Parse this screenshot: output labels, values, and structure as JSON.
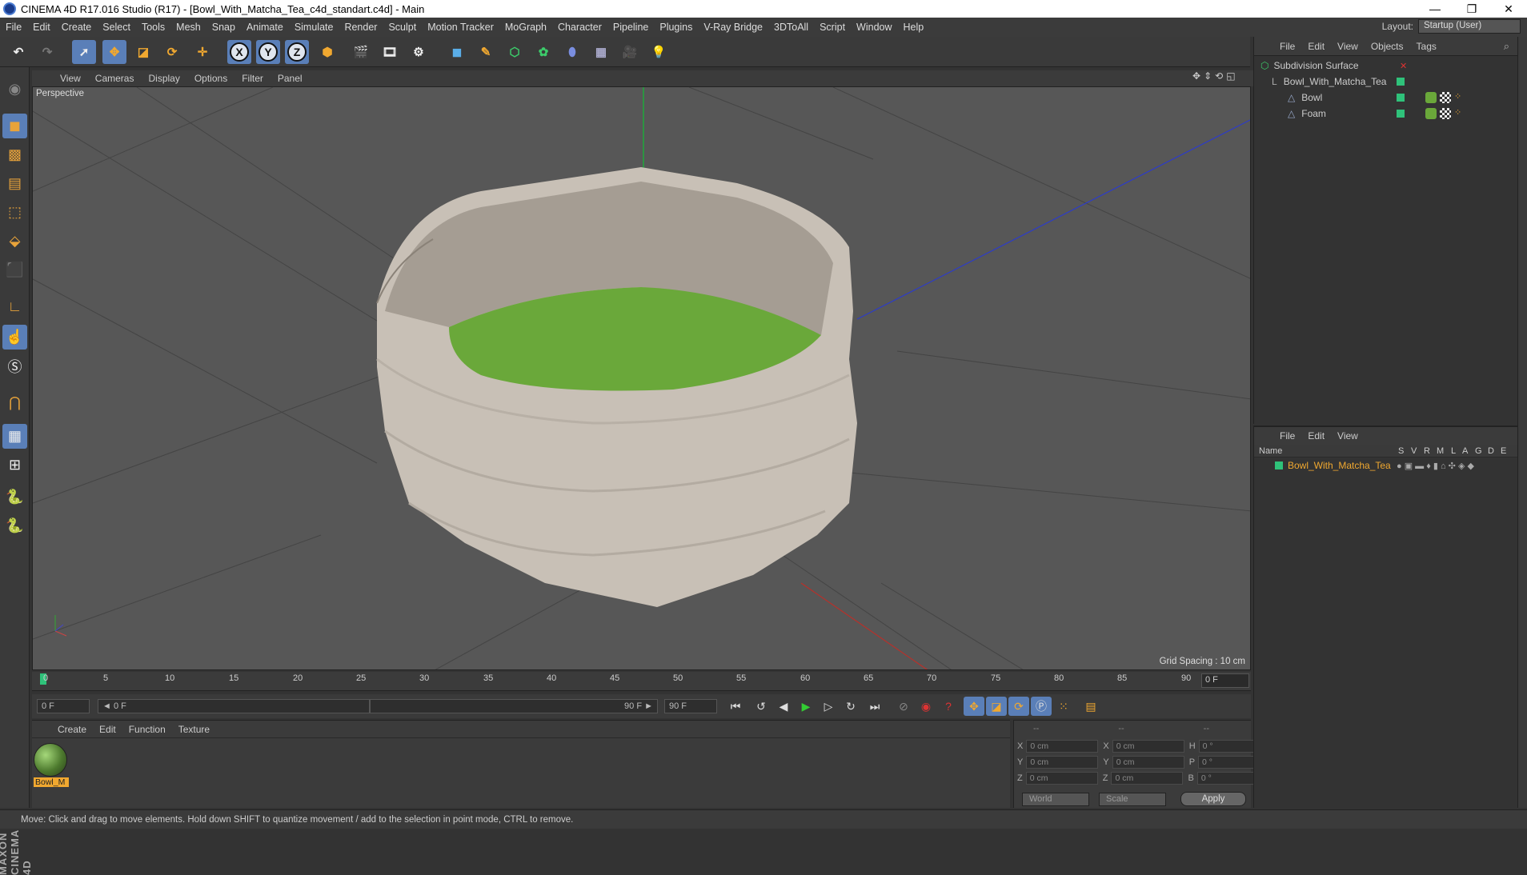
{
  "title": "CINEMA 4D R17.016 Studio (R17) - [Bowl_With_Matcha_Tea_c4d_standart.c4d] - Main",
  "window_buttons": [
    "—",
    "❐",
    "✕"
  ],
  "menu": [
    "File",
    "Edit",
    "Create",
    "Select",
    "Tools",
    "Mesh",
    "Snap",
    "Animate",
    "Simulate",
    "Render",
    "Sculpt",
    "Motion Tracker",
    "MoGraph",
    "Character",
    "Pipeline",
    "Plugins",
    "V-Ray Bridge",
    "3DToAll",
    "Script",
    "Window",
    "Help"
  ],
  "layout": {
    "label": "Layout:",
    "value": "Startup (User)"
  },
  "viewport": {
    "menu": [
      "View",
      "Cameras",
      "Display",
      "Options",
      "Filter",
      "Panel"
    ],
    "label": "Perspective",
    "grid_spacing": "Grid Spacing : 10 cm"
  },
  "timeline": {
    "ticks": [
      "0",
      "5",
      "10",
      "15",
      "20",
      "25",
      "30",
      "35",
      "40",
      "45",
      "50",
      "55",
      "60",
      "65",
      "70",
      "75",
      "80",
      "85",
      "90"
    ],
    "current_frame": "0 F"
  },
  "transport": {
    "start": "0 F",
    "range_start": "◄ 0 F",
    "range_end": "90 F ►",
    "end": "90 F"
  },
  "material": {
    "menu": [
      "Create",
      "Edit",
      "Function",
      "Texture"
    ],
    "item_label": "Bowl_M"
  },
  "coords": {
    "headers": [
      "--",
      "--",
      "--"
    ],
    "rows": [
      {
        "a": "X",
        "av": "0 cm",
        "b": "X",
        "bv": "0 cm",
        "c": "H",
        "cv": "0 °"
      },
      {
        "a": "Y",
        "av": "0 cm",
        "b": "Y",
        "bv": "0 cm",
        "c": "P",
        "cv": "0 °"
      },
      {
        "a": "Z",
        "av": "0 cm",
        "b": "Z",
        "bv": "0 cm",
        "c": "B",
        "cv": "0 °"
      }
    ],
    "world": "World",
    "scale": "Scale",
    "apply": "Apply"
  },
  "objects": {
    "menu": [
      "File",
      "Edit",
      "View",
      "Objects",
      "Tags"
    ],
    "items": [
      {
        "name": "Subdivision Surface"
      },
      {
        "name": "Bowl_With_Matcha_Tea"
      },
      {
        "name": "Bowl"
      },
      {
        "name": "Foam"
      }
    ]
  },
  "attributes": {
    "menu": [
      "File",
      "Edit",
      "View"
    ],
    "columns": [
      "Name",
      "S",
      "V",
      "R",
      "M",
      "L",
      "A",
      "G",
      "D",
      "E"
    ],
    "row": "Bowl_With_Matcha_Tea"
  },
  "status": "Move: Click and drag to move elements. Hold down SHIFT to quantize movement / add to the selection in point mode, CTRL to remove.",
  "brand": "MAXON CINEMA 4D",
  "colors": {
    "accent": "#5a7fb8",
    "selection": "#f0a830",
    "enabled": "#2fc27a"
  }
}
